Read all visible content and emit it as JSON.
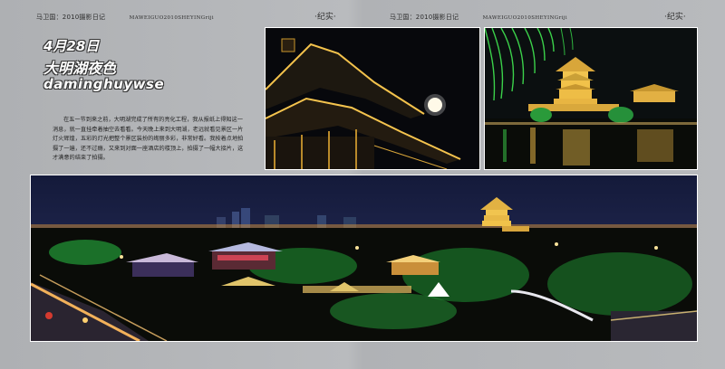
{
  "left_page": {
    "header_cn": "马卫国：2010摄影日记",
    "header_en": "MAWEIGUO2010SHEYINGriji",
    "mark": "·纪实·",
    "title_line1": "4月28日",
    "title_line2": "大明湖夜色",
    "title_line3": "daminghuywse",
    "paragraph": "在五一节到来之前，大明湖完成了所有的亮化工程，我从报纸上得知这一消息，就一直挂牵着抽空去看看。今天晚上来到大明湖，老远就看见景区一片灯火辉煌，五彩的灯光把整个景区装扮的绚丽多彩，非常好看。我按着点地拍摄了一遍，还不过瘾，又来到对面一座酒店的楼顶上，拍摄了一幅大接片，这才满意的结束了拍摄。"
  },
  "right_page": {
    "header_cn": "马卫国：2010摄影日记",
    "header_en": "MAWEIGUO2010SHEYINGriji",
    "mark": "·纪实·"
  },
  "photos": {
    "pavilion_moon": "pavilion-moon-photo",
    "lakeside_tower": "lakeside-tower-photo",
    "panorama": "night-panorama-photo"
  },
  "colors": {
    "background": "#b3b5b8",
    "night_sky": "#0a0d1c",
    "gold_lights": "#f2c24a",
    "green_lights": "#3ed14a"
  }
}
